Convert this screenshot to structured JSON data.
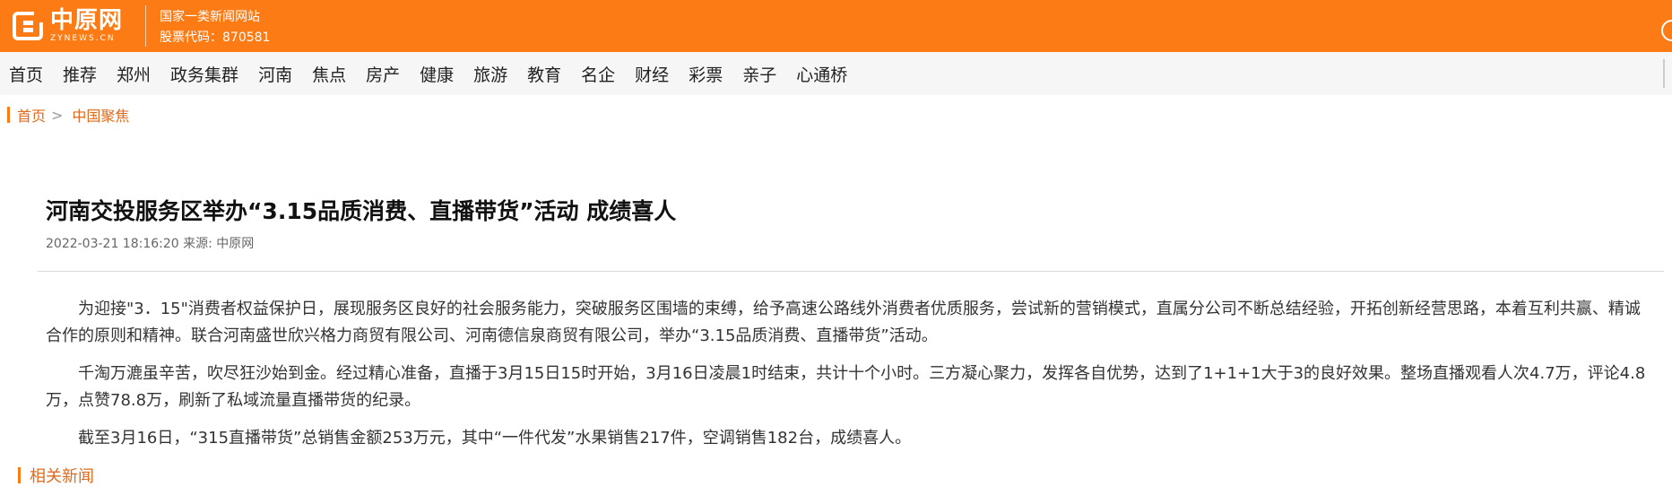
{
  "header": {
    "logo_cn": "中原网",
    "logo_en": "ZYNEWS.CN",
    "site_tagline": "国家一类新闻网站",
    "stock_code": "股票代码：870581"
  },
  "nav": {
    "items": [
      "首页",
      "推荐",
      "郑州",
      "政务集群",
      "河南",
      "焦点",
      "房产",
      "健康",
      "旅游",
      "教育",
      "名企",
      "财经",
      "彩票",
      "亲子",
      "心通桥"
    ]
  },
  "breadcrumb": {
    "home": "首页",
    "separator": ">",
    "current": "中国聚焦"
  },
  "article": {
    "title": "河南交投服务区举办“3.15品质消费、直播带货”活动 成绩喜人",
    "meta": "2022-03-21 18:16:20 来源: 中原网",
    "paragraphs": [
      "为迎接\"3．15\"消费者权益保护日，展现服务区良好的社会服务能力，突破服务区围墙的束缚，给予高速公路线外消费者优质服务，尝试新的营销模式，直属分公司不断总结经验，开拓创新经营思路，本着互利共赢、精诚合作的原则和精神。联合河南盛世欣兴格力商贸有限公司、河南德信泉商贸有限公司，举办“3.15品质消费、直播带货”活动。",
      "千淘万漉虽辛苦，吹尽狂沙始到金。经过精心准备，直播于3月15日15时开始，3月16日凌晨1时结束，共计十个小时。三方凝心聚力，发挥各自优势，达到了1+1+1大于3的良好效果。整场直播观看人次4.7万，评论4.8万，点赞78.8万，刷新了私域流量直播带货的纪录。",
      "截至3月16日，“315直播带货”总销售金额253万元，其中“一件代发”水果销售217件，空调销售182台，成绩喜人。"
    ]
  },
  "related": {
    "label": "相关新闻"
  },
  "colors": {
    "brand_orange": "#fd7b15",
    "link_orange": "#e06a1e",
    "nav_bg": "#f6f6f6"
  }
}
